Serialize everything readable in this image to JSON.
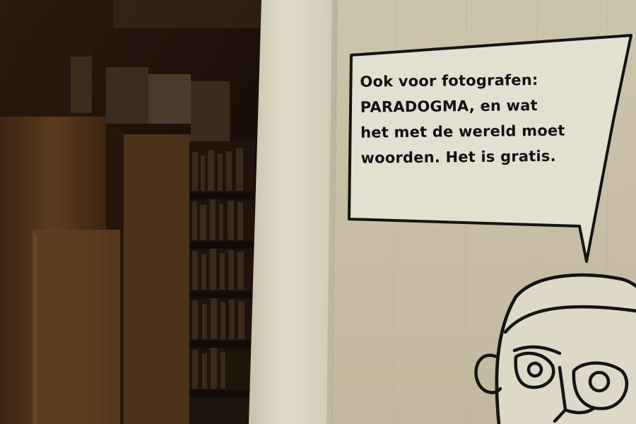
{
  "speech_bubble": {
    "lines": [
      "Ook voor fotografen:",
      "PARADOGMA, en wat",
      "het met de wereld moet",
      "woorden. Het is gratis."
    ]
  },
  "palette": {
    "room_dark": "#1c120a",
    "cabinet_wood": "#5a3a1e",
    "wall_pillar": "#d8d2bf",
    "wall_panel": "#cdc4ad",
    "bubble_fill": "#e6e2d4",
    "ink": "#121212"
  }
}
